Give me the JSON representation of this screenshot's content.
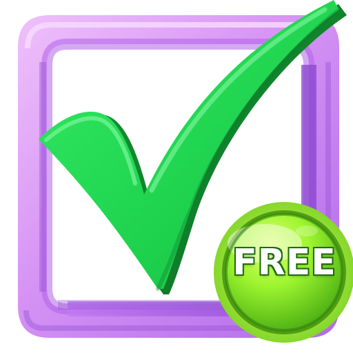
{
  "badge": {
    "label": "FREE"
  },
  "icons": {
    "frame": "checkbox-frame-icon",
    "check": "checkmark-icon",
    "badge": "free-badge-icon"
  },
  "colors": {
    "frame_light": "#e4a4f7",
    "frame_mid": "#c77cf0",
    "frame_dark": "#8f49d0",
    "check_light": "#41e56b",
    "check_mid": "#1ccf4a",
    "check_dark": "#118f2f",
    "badge_light": "#b8ff42",
    "badge_mid": "#62d719",
    "badge_dark": "#2f8d0a"
  }
}
